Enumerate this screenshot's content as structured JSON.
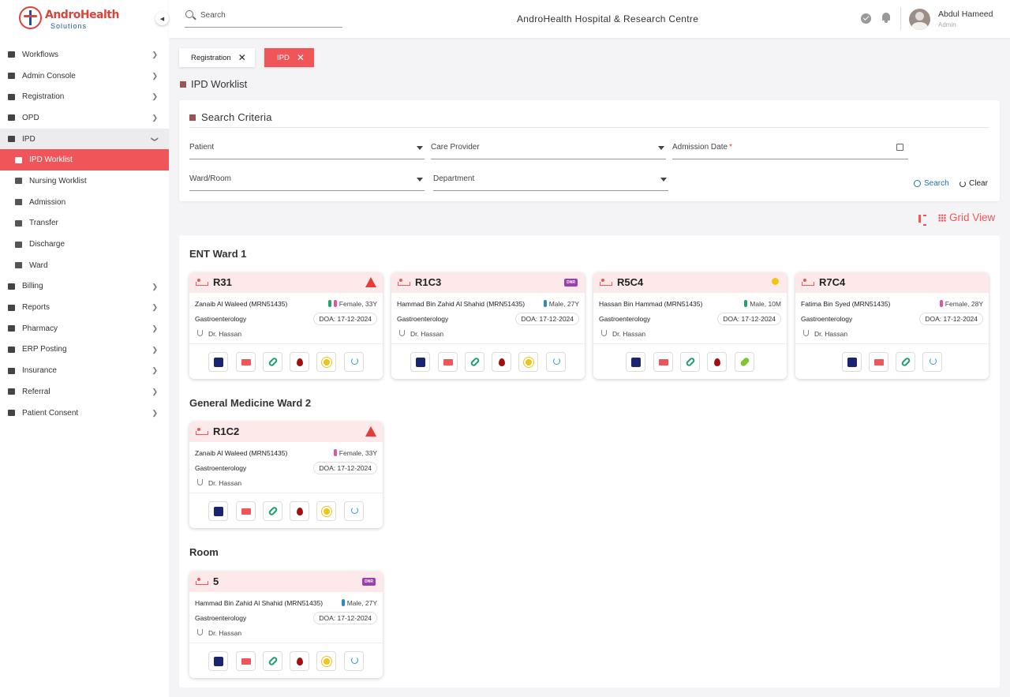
{
  "brand": {
    "name": "AndroHealth",
    "sub": "Solutions"
  },
  "sidebar": {
    "items": [
      {
        "label": "Workflows",
        "icon": "workflow-icon"
      },
      {
        "label": "Admin Console",
        "icon": "gear-icon"
      },
      {
        "label": "Registration",
        "icon": "registration-icon"
      },
      {
        "label": "OPD",
        "icon": "opd-icon"
      },
      {
        "label": "IPD",
        "icon": "bed-icon"
      },
      {
        "label": "IPD Worklist",
        "icon": "worklist-icon"
      },
      {
        "label": "Nursing Worklist",
        "icon": "nursing-icon"
      },
      {
        "label": "Admission",
        "icon": "admission-icon"
      },
      {
        "label": "Transfer",
        "icon": "transfer-icon"
      },
      {
        "label": "Discharge",
        "icon": "discharge-icon"
      },
      {
        "label": "Ward",
        "icon": "ward-icon"
      },
      {
        "label": "Billing",
        "icon": "billing-icon"
      },
      {
        "label": "Reports",
        "icon": "reports-icon"
      },
      {
        "label": "Pharmacy",
        "icon": "pharmacy-icon"
      },
      {
        "label": "ERP Posting",
        "icon": "erp-icon"
      },
      {
        "label": "Insurance",
        "icon": "insurance-icon"
      },
      {
        "label": "Referral",
        "icon": "referral-icon"
      },
      {
        "label": "Patient Consent",
        "icon": "consent-icon"
      }
    ]
  },
  "topbar": {
    "search_placeholder": "Search",
    "hospital": "AndroHealth Hospital & Research Centre",
    "user_name": "Abdul Hameed",
    "user_role": "Admin"
  },
  "tabs": [
    {
      "label": "Registration"
    },
    {
      "label": "IPD"
    }
  ],
  "page_title": "IPD Worklist",
  "criteria": {
    "title": "Search Criteria",
    "patient": "Patient",
    "care_provider": "Care Provider",
    "admission_date": "Admission Date",
    "required_mark": "*",
    "ward_room": "Ward/Room",
    "department": "Department",
    "search_label": "Search",
    "clear_label": "Clear"
  },
  "view_label": "Grid View",
  "sections": [
    {
      "title": "ENT Ward 1"
    },
    {
      "title": "General Medicine Ward 2"
    },
    {
      "title": "Room"
    }
  ],
  "accent": "#f05559",
  "beds": [
    {
      "bed": "R31",
      "patient": "Zanaib Al Waleed (MRN51435)",
      "gender": "Female,",
      "age": "33Y",
      "dept": "Gastroenterology",
      "doa": "DOA: 17-12-2024",
      "doctor": "Dr. Hassan",
      "flag": "warning-icon"
    },
    {
      "bed": "R1C3",
      "patient": "Hammad Bin Zahid Al Shahid (MRN51435)",
      "gender": "Male,",
      "age": "27Y",
      "dept": "Gastroenterology",
      "doa": "DOA: 17-12-2024",
      "doctor": "Dr. Hassan",
      "flag": "DNR"
    },
    {
      "bed": "R5C4",
      "patient": "Hassan Bin Hammad (MRN51435)",
      "gender": "Male,",
      "age": "10M",
      "dept": "Gastroenterology",
      "doa": "DOA: 17-12-2024",
      "doctor": "Dr. Hassan",
      "flag": "sparkle-icon"
    },
    {
      "bed": "R7C4",
      "patient": "Fatima Bin Syed (MRN51435)",
      "gender": "Female,",
      "age": "28Y",
      "dept": "Gastroenterology",
      "doa": "DOA: 17-12-2024",
      "doctor": "Dr. Hassan",
      "flag": ""
    },
    {
      "bed": "R1C2",
      "patient": "Zanaib Al Waleed (MRN51435)",
      "gender": "Female,",
      "age": "33Y",
      "dept": "Gastroenterology",
      "doa": "DOA: 17-12-2024",
      "doctor": "Dr. Hassan",
      "flag": "warning-icon"
    },
    {
      "bed": "5",
      "patient": "Hammad Bin Zahid Al Shahid (MRN51435)",
      "gender": "Male,",
      "age": "27Y",
      "dept": "Gastroenterology",
      "doa": "DOA: 17-12-2024",
      "doctor": "Dr. Hassan",
      "flag": "DNR"
    }
  ]
}
